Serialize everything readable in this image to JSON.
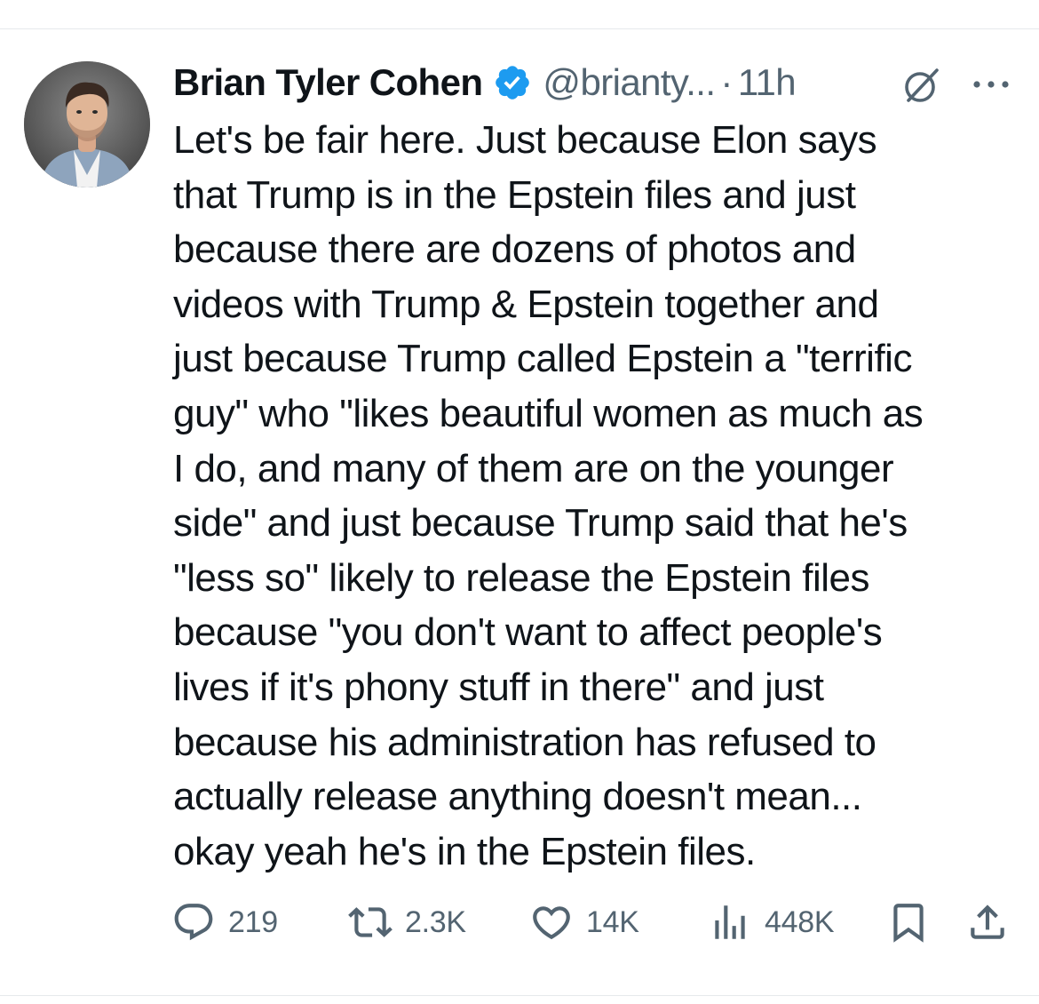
{
  "author": {
    "display_name": "Brian Tyler Cohen",
    "handle": "@brianty...",
    "separator": "·",
    "time": "11h",
    "verified": true,
    "avatar_icon": "avatar-photo"
  },
  "tweet": {
    "text": "Let's be fair here. Just because Elon says\nthat Trump is in the Epstein files and just\nbecause there are dozens of photos and\nvideos with Trump & Epstein together and\njust because Trump called Epstein a \"terrific\nguy\" who \"likes beautiful women as much as\nI do, and many of them are on the younger\nside\" and just because Trump said that he's\n\"less so\" likely to release the Epstein files\nbecause \"you don't want to affect people's\nlives if it's phony stuff in there\" and just\nbecause his administration has refused to\nactually release anything doesn't mean...\nokay yeah he's in the Epstein files."
  },
  "actions": {
    "replies": "219",
    "reposts": "2.3K",
    "likes": "14K",
    "views": "448K"
  },
  "icons": {
    "verified": "verified-badge-icon",
    "grok": "grok-icon",
    "more": "more-options-icon",
    "reply": "reply-icon",
    "repost": "repost-icon",
    "like": "heart-icon",
    "views": "views-icon",
    "bookmark": "bookmark-icon",
    "share": "share-icon"
  },
  "colors": {
    "text": "#0f1419",
    "secondary": "#536471",
    "verified": "#1d9bf0"
  }
}
